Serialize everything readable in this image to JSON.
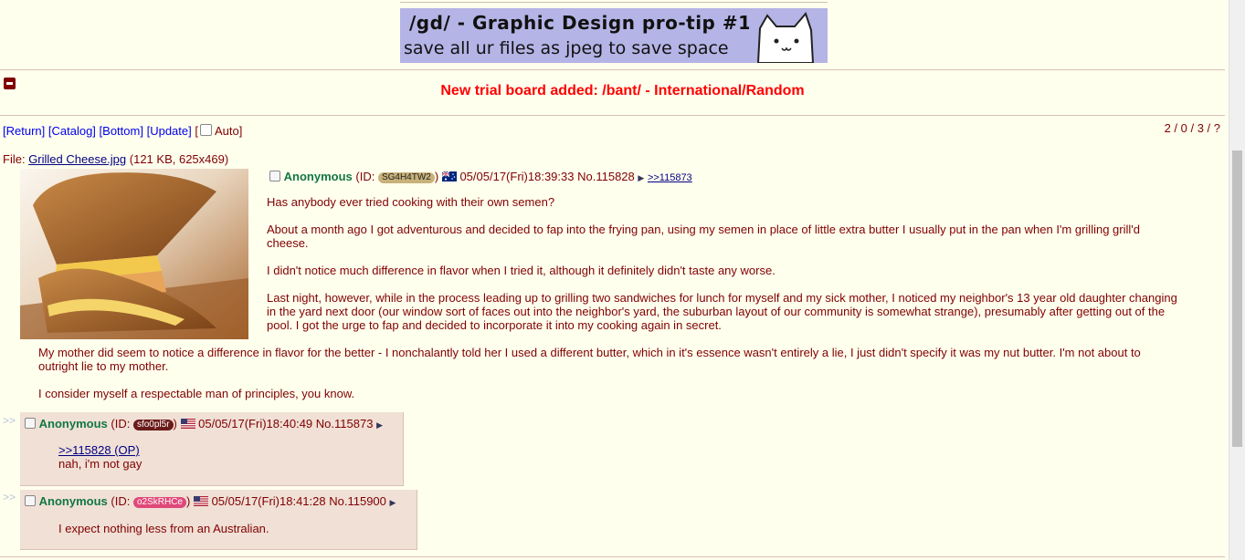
{
  "banner": {
    "line1": "/gd/ - Graphic Design pro-tip #1",
    "line2": "save all ur files as jpeg to save space"
  },
  "announcement": "New trial board added: /bant/ - International/Random",
  "nav": {
    "return": "[Return]",
    "catalog": "[Catalog]",
    "bottom": "[Bottom]",
    "update": "[Update]",
    "auto_open": "[",
    "auto": "Auto]"
  },
  "page_info": "2 / 0 / 3 / ?",
  "op": {
    "file_label": "File:",
    "file_name": "Grilled Cheese.jpg",
    "file_meta": "(121 KB, 625x469)",
    "name": "Anonymous",
    "id_prefix": "(ID:",
    "id": "SG4H4TW2",
    "id_suffix": ")",
    "datetime": "05/05/17(Fri)18:39:33",
    "no": "No.115828",
    "backlink": ">>115873",
    "paragraphs": [
      "Has anybody ever tried cooking with their own semen?",
      "About a month ago I got adventurous and decided to fap into the frying pan, using my semen in place of little extra butter I usually put in the pan when I'm grilling grill'd cheese.",
      "I didn't notice much difference in flavor when I tried it, although it definitely didn't taste any worse.",
      "Last night, however, while in the process leading up to grilling two sandwiches for lunch for myself and my sick mother, I noticed my neighbor's 13 year old daughter changing in the yard next door (our window sort of faces out into the neighbor's yard, the suburban layout of our community is somewhat strange), presumably after getting out of the pool. I got the urge to fap and decided to incorporate it into my cooking again in secret."
    ],
    "paragraphs_below": [
      "My mother did seem to notice a difference in flavor for the better - I nonchalantly told her I used a different butter, which in it's essence wasn't entirely a lie, I just didn't specify it was my nut butter. I'm not about to outright lie to my mother.",
      "I consider myself a respectable man of principles, you know."
    ],
    "flag": "au"
  },
  "replies": [
    {
      "arrow": ">>",
      "name": "Anonymous",
      "id_prefix": "(ID:",
      "id": "sfo0pl5r",
      "id_suffix": ")",
      "datetime": "05/05/17(Fri)18:40:49",
      "no": "No.115873",
      "quote": ">>115828 (OP)",
      "text": "nah, i'm not gay",
      "flag": "us",
      "id_bg": "#6B1A1A"
    },
    {
      "arrow": ">>",
      "name": "Anonymous",
      "id_prefix": "(ID:",
      "id": "o2SkRHCe",
      "id_suffix": ")",
      "datetime": "05/05/17(Fri)18:41:28",
      "no": "No.115900",
      "quote": "",
      "text": "I expect nothing less from an Australian.",
      "flag": "us",
      "id_bg": "#E0487A"
    }
  ],
  "colors": {
    "background": "#FFFFEE",
    "text": "#800000",
    "name": "#117743",
    "announcement": "#FF0000",
    "reply_bg": "#F0E0D6",
    "op_id_bg": "#C8B27A"
  }
}
